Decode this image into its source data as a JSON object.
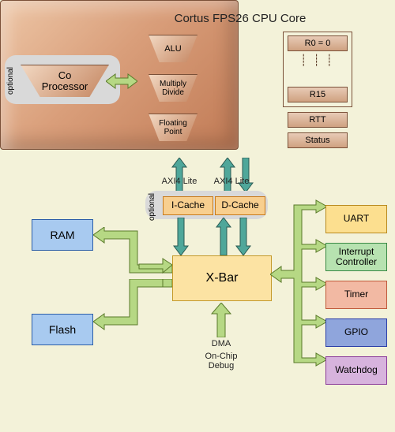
{
  "cpu": {
    "title": "Cortus FPS26 CPU Core",
    "units": {
      "alu": "ALU",
      "muldiv": "Multiply\nDivide",
      "fp": "Floating\nPoint"
    },
    "coprocessor": "Co\nProcessor",
    "optional_label": "optional",
    "registers": {
      "r0": "R0  =  0",
      "r15": "R15",
      "rtt": "RTT",
      "status": "Status"
    }
  },
  "bus": {
    "axi4_lite": "AXI4 Lite",
    "icache": "I-Cache",
    "dcache": "D-Cache",
    "xbar": "X-Bar",
    "dma": "DMA",
    "ocd": "On-Chip\nDebug",
    "optional_label": "optional"
  },
  "mem": {
    "ram": "RAM",
    "flash": "Flash"
  },
  "periph": {
    "uart": "UART",
    "intc": "Interrupt\nController",
    "timer": "Timer",
    "gpio": "GPIO",
    "wdog": "Watchdog"
  }
}
